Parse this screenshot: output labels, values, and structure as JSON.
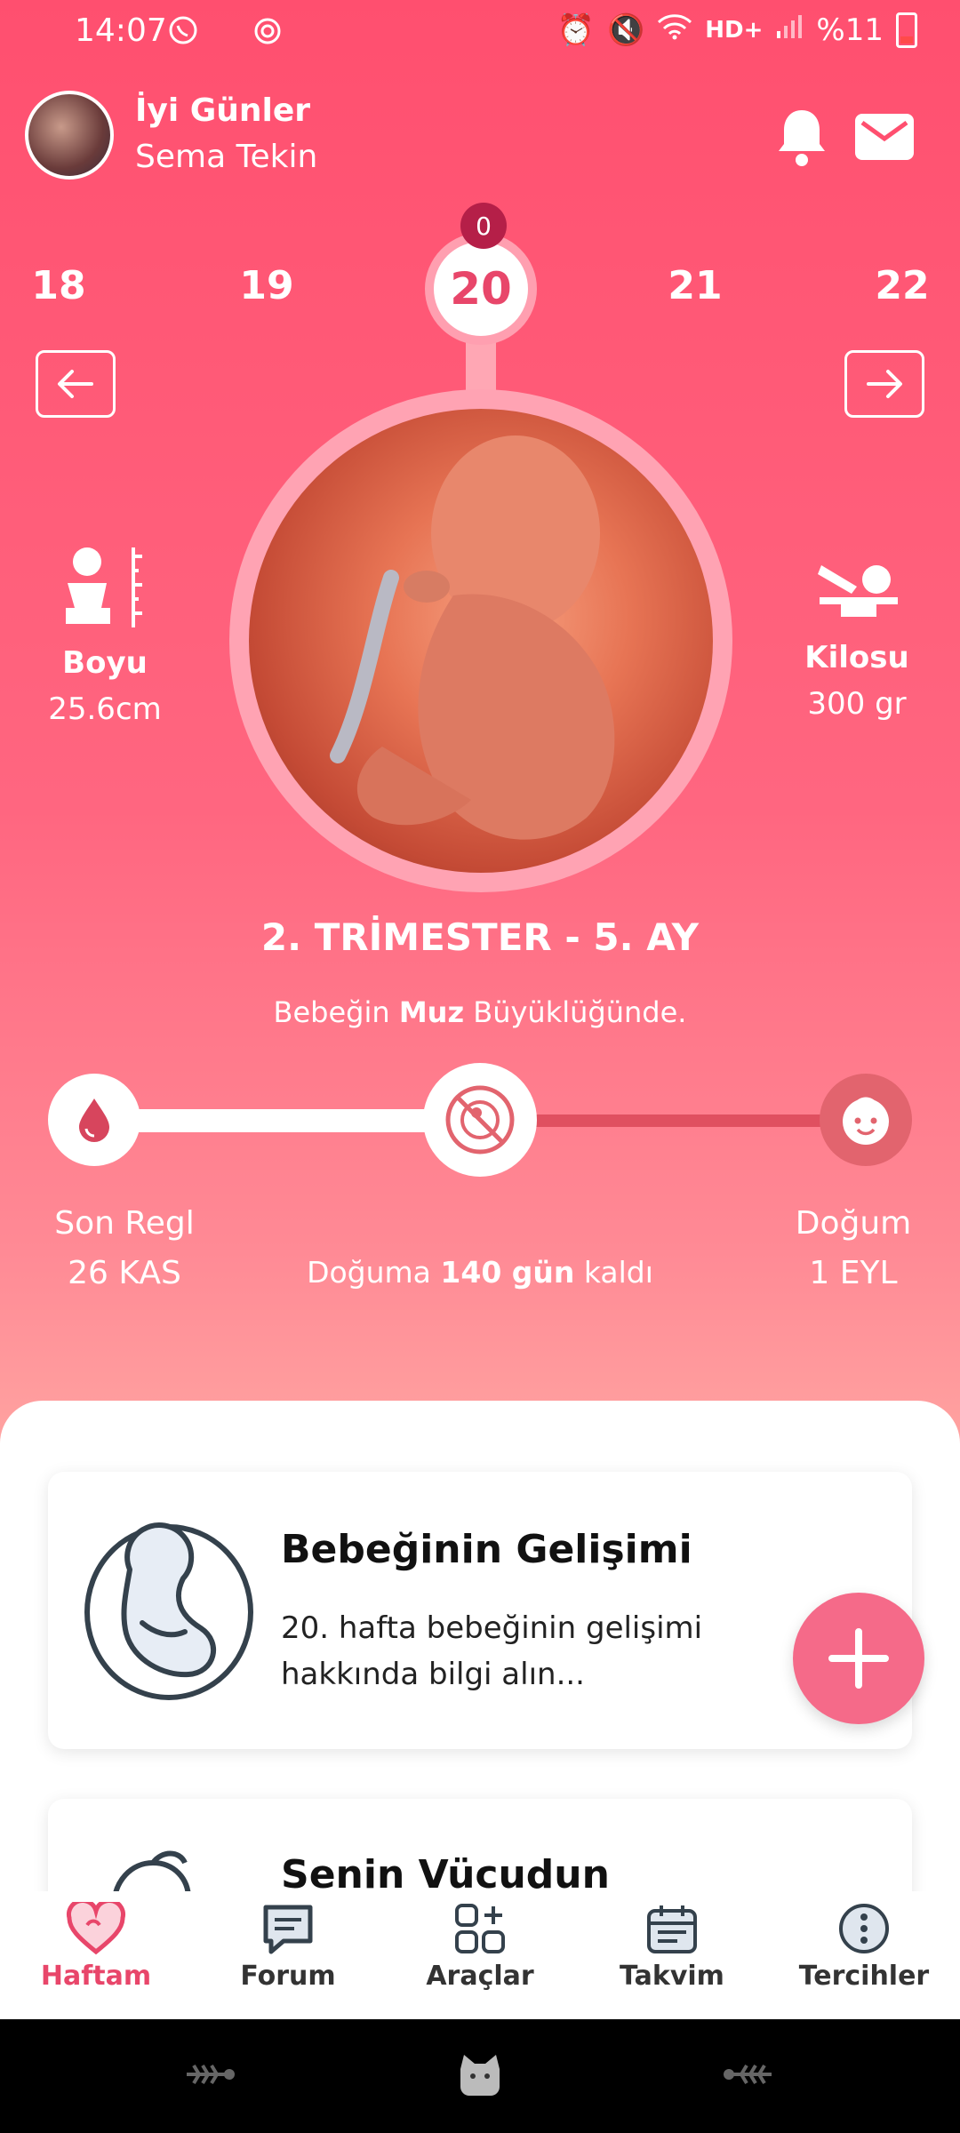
{
  "status": {
    "time": "14:07",
    "network": "HD+",
    "battery": "%11"
  },
  "header": {
    "greeting": "İyi Günler",
    "user_name": "Sema Tekin"
  },
  "weeks": {
    "items": [
      "18",
      "19",
      "20",
      "21",
      "22"
    ],
    "current": "20",
    "badge": "0"
  },
  "stats": {
    "height_label": "Boyu",
    "height_value": "25.6cm",
    "weight_label": "Kilosu",
    "weight_value": "300 gr"
  },
  "trimester": "2. TRİMESTER - 5. AY",
  "size": {
    "prefix": "Bebeğin ",
    "fruit": "Muz",
    "suffix": " Büyüklüğünde."
  },
  "timeline": {
    "start_label": "Son Regl",
    "start_date": "26 KAS",
    "end_label": "Doğum",
    "end_date": "1 EYL",
    "countdown_prefix": "Doğuma ",
    "countdown_value": "140 gün",
    "countdown_suffix": " kaldı",
    "progress": 0.5
  },
  "cards": [
    {
      "title": "Bebeğinin Gelişimi",
      "desc_line1": "20. hafta bebeğinin gelişimi",
      "desc_line2": "hakkında bilgi alın..."
    },
    {
      "title": "Senin Vücudun"
    }
  ],
  "nav": [
    {
      "label": "Haftam",
      "icon": "heart-icon",
      "active": true
    },
    {
      "label": "Forum",
      "icon": "chat-icon"
    },
    {
      "label": "Araçlar",
      "icon": "grid-plus-icon"
    },
    {
      "label": "Takvim",
      "icon": "calendar-icon"
    },
    {
      "label": "Tercihler",
      "icon": "more-vertical-icon"
    }
  ],
  "colors": {
    "accent": "#e8466a",
    "fab": "#f56a89",
    "header_top": "#ff4f6f"
  }
}
